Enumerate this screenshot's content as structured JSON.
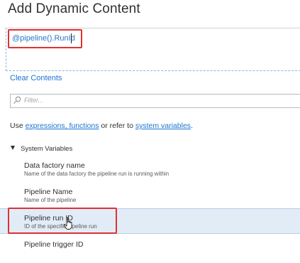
{
  "title": "Add Dynamic Content",
  "editor": {
    "expression": "@pipeline().RunId"
  },
  "clear_contents_label": "Clear Contents",
  "filter": {
    "placeholder": "Filter..."
  },
  "help": {
    "prefix": "Use ",
    "link1": "expressions, functions",
    "middle": " or refer to ",
    "link2": "system variables",
    "suffix": "."
  },
  "section": {
    "label": "System Variables",
    "expanded": true
  },
  "items": [
    {
      "name": "Data factory name",
      "description": "Name of the data factory the pipeline run is running within"
    },
    {
      "name": "Pipeline Name",
      "description": "Name of the pipeline"
    },
    {
      "name": "Pipeline run ID",
      "description": "ID of the specific pipeline run",
      "selected": true
    },
    {
      "name": "Pipeline trigger ID",
      "description": ""
    }
  ],
  "colors": {
    "accent": "#1a73d3",
    "highlight": "#e03131",
    "selected_bg": "#e1ecf7"
  }
}
